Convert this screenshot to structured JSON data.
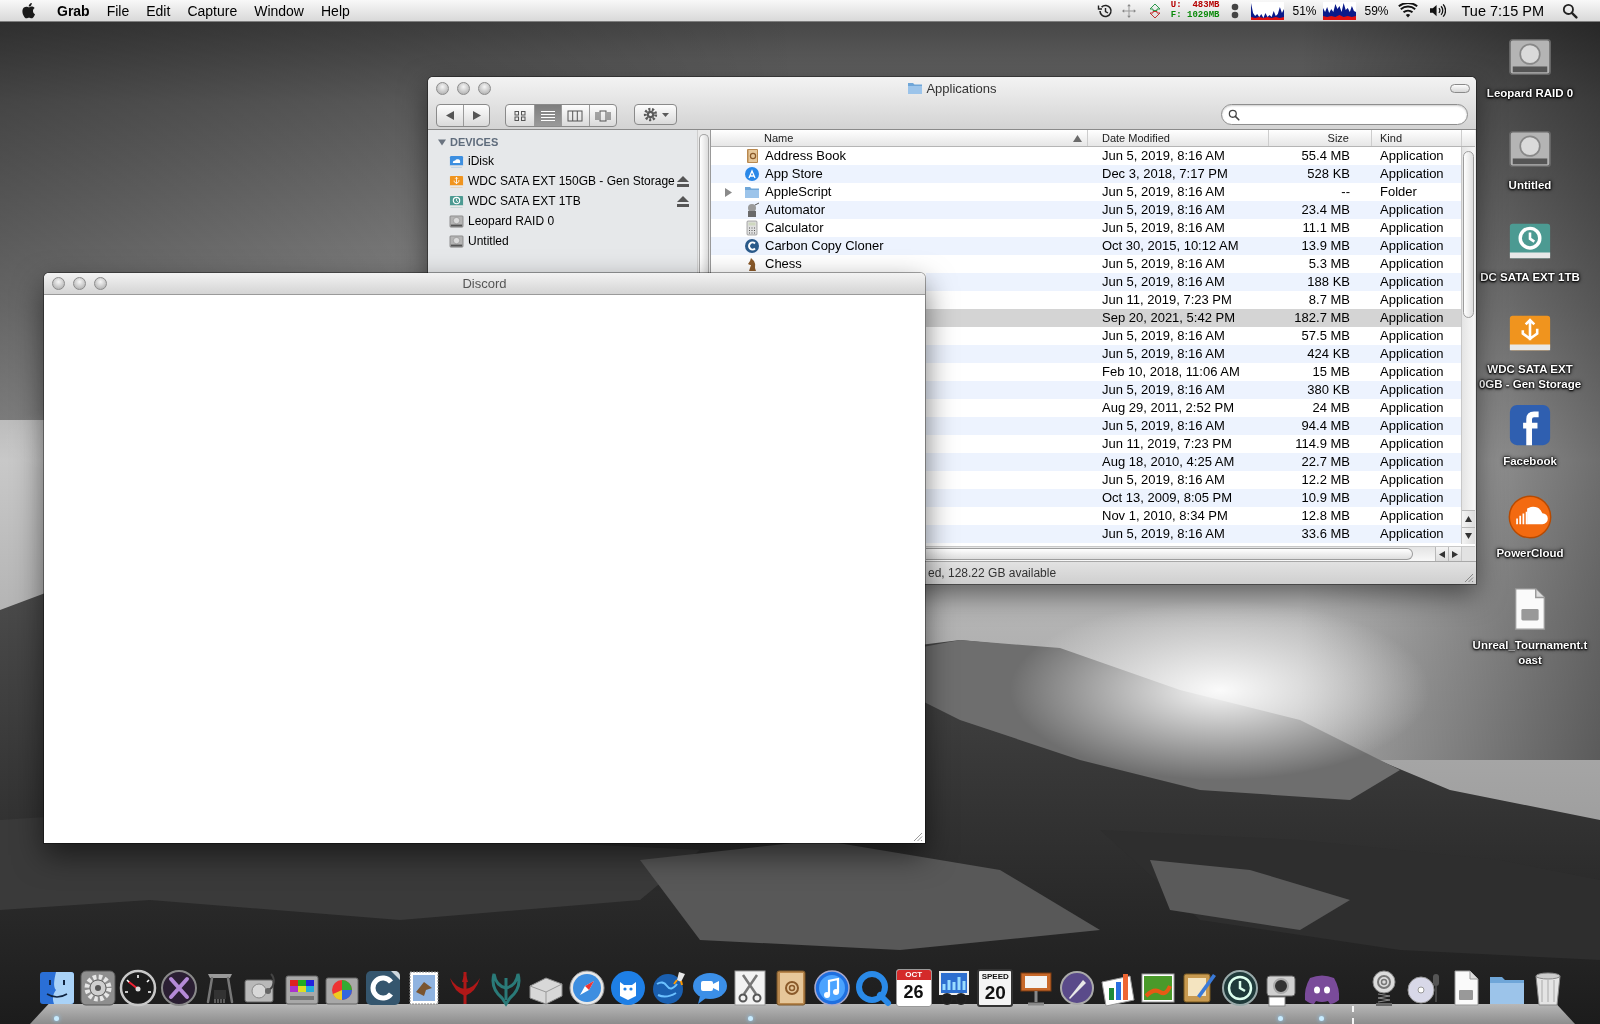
{
  "menu_bar": {
    "app_name": "Grab",
    "menus": [
      "File",
      "Edit",
      "Capture",
      "Window",
      "Help"
    ],
    "memory": [
      {
        "text": "U:  483MB",
        "color": "#b40000"
      },
      {
        "text": "F: 1029MB",
        "color": "#0a8a0a"
      }
    ],
    "meter_readings": [
      "51%",
      "59%"
    ],
    "clock": "Tue 7:15 PM"
  },
  "finder_window": {
    "title": "Applications",
    "view_modes": [
      {
        "selected": false
      },
      {
        "selected": true
      },
      {
        "selected": false
      },
      {
        "selected": false
      }
    ],
    "sidebar": {
      "heading": "DEVICES",
      "expanded": true,
      "items": [
        {
          "label": "iDisk",
          "kind": "idisk",
          "ejectable": false
        },
        {
          "label": "WDC SATA EXT 150GB - Gen Storage",
          "kind": "usb-drive",
          "ejectable": true
        },
        {
          "label": "WDC SATA EXT 1TB",
          "kind": "backup-drive",
          "ejectable": true
        },
        {
          "label": "Leopard RAID 0",
          "kind": "internal-drive",
          "ejectable": false
        },
        {
          "label": "Untitled",
          "kind": "internal-drive",
          "ejectable": false
        }
      ]
    },
    "columns": [
      {
        "label": "Name",
        "sorted": true
      },
      {
        "label": "Date Modified",
        "sorted": false
      },
      {
        "label": "Size",
        "sorted": false
      },
      {
        "label": "Kind",
        "sorted": false
      }
    ],
    "rows": [
      {
        "name": "Address Book",
        "kind": "address-book",
        "date_modified": "Jun 5, 2019, 8:16 AM",
        "size": "55.4 MB",
        "file_kind": "Application",
        "selected": false
      },
      {
        "name": "App Store",
        "kind": "app-store",
        "date_modified": "Dec 3, 2018, 7:17 PM",
        "size": "528 KB",
        "file_kind": "Application",
        "selected": false
      },
      {
        "name": "AppleScript",
        "kind": "folder",
        "date_modified": "Jun 5, 2019, 8:16 AM",
        "size": "--",
        "file_kind": "Folder",
        "selected": false
      },
      {
        "name": "Automator",
        "kind": "automator",
        "date_modified": "Jun 5, 2019, 8:16 AM",
        "size": "23.4 MB",
        "file_kind": "Application",
        "selected": false
      },
      {
        "name": "Calculator",
        "kind": "calculator",
        "date_modified": "Jun 5, 2019, 8:16 AM",
        "size": "11.1 MB",
        "file_kind": "Application",
        "selected": false
      },
      {
        "name": "Carbon Copy Cloner",
        "kind": "cloner",
        "date_modified": "Oct 30, 2015, 10:12 AM",
        "size": "13.9 MB",
        "file_kind": "Application",
        "selected": false
      },
      {
        "name": "Chess",
        "kind": "chess",
        "date_modified": "Jun 5, 2019, 8:16 AM",
        "size": "5.3 MB",
        "file_kind": "Application",
        "selected": false
      },
      {
        "date_modified": "Jun 5, 2019, 8:16 AM",
        "size": "188 KB",
        "file_kind": "Application",
        "selected": false
      },
      {
        "date_modified": "Jun 11, 2019, 7:23 PM",
        "size": "8.7 MB",
        "file_kind": "Application",
        "selected": false
      },
      {
        "date_modified": "Sep 20, 2021, 5:42 PM",
        "size": "182.7 MB",
        "file_kind": "Application",
        "selected": true
      },
      {
        "date_modified": "Jun 5, 2019, 8:16 AM",
        "size": "57.5 MB",
        "file_kind": "Application",
        "selected": false
      },
      {
        "date_modified": "Jun 5, 2019, 8:16 AM",
        "size": "424 KB",
        "file_kind": "Application",
        "selected": false
      },
      {
        "date_modified": "Feb 10, 2018, 11:06 AM",
        "size": "15 MB",
        "file_kind": "Application",
        "selected": false
      },
      {
        "date_modified": "Jun 5, 2019, 8:16 AM",
        "size": "380 KB",
        "file_kind": "Application",
        "selected": false
      },
      {
        "date_modified": "Aug 29, 2011, 2:52 PM",
        "size": "24 MB",
        "file_kind": "Application",
        "selected": false
      },
      {
        "date_modified": "Jun 5, 2019, 8:16 AM",
        "size": "94.4 MB",
        "file_kind": "Application",
        "selected": false
      },
      {
        "date_modified": "Jun 11, 2019, 7:23 PM",
        "size": "114.9 MB",
        "file_kind": "Application",
        "selected": false
      },
      {
        "date_modified": "Aug 18, 2010, 4:25 AM",
        "size": "22.7 MB",
        "file_kind": "Application",
        "selected": false
      },
      {
        "date_modified": "Jun 5, 2019, 8:16 AM",
        "size": "12.2 MB",
        "file_kind": "Application",
        "selected": false
      },
      {
        "date_modified": "Oct 13, 2009, 8:05 PM",
        "size": "10.9 MB",
        "file_kind": "Application",
        "selected": false
      },
      {
        "date_modified": "Nov 1, 2010, 8:34 PM",
        "size": "12.8 MB",
        "file_kind": "Application",
        "selected": false
      },
      {
        "date_modified": "Jun 5, 2019, 8:16 AM",
        "size": "33.6 MB",
        "file_kind": "Application",
        "selected": false
      }
    ],
    "status": "ed, 128.22 GB available"
  },
  "discord_window": {
    "title": "Discord"
  },
  "desktop_icons": [
    {
      "kind": "internal-drive",
      "label_lines": [
        "Leopard RAID 0"
      ]
    },
    {
      "kind": "internal-drive",
      "label_lines": [
        "Untitled"
      ]
    },
    {
      "kind": "backup-drive",
      "label_lines": [
        "DC SATA EXT 1TB"
      ]
    },
    {
      "kind": "usb-drive",
      "label_lines": [
        "WDC SATA EXT",
        "0GB - Gen Storage"
      ]
    },
    {
      "kind": "facebook-app",
      "label_lines": [
        "Facebook"
      ]
    },
    {
      "kind": "cloud-app",
      "label_lines": [
        "PowerCloud"
      ]
    },
    {
      "kind": "document",
      "label_lines": [
        "Unreal_Tournament.t",
        "oast"
      ]
    }
  ],
  "dock": {
    "items": [
      {
        "kind": "app",
        "running": true
      },
      {
        "kind": "app",
        "running": false
      },
      {
        "kind": "app",
        "running": false
      },
      {
        "kind": "app",
        "running": false
      },
      {
        "kind": "app",
        "running": false
      },
      {
        "kind": "app",
        "running": false
      },
      {
        "kind": "app",
        "running": false
      },
      {
        "kind": "app",
        "running": false
      },
      {
        "kind": "app",
        "running": false
      },
      {
        "kind": "app",
        "running": false
      },
      {
        "kind": "app",
        "running": false
      },
      {
        "kind": "app",
        "running": false
      },
      {
        "kind": "app",
        "running": false
      },
      {
        "kind": "app",
        "running": false
      },
      {
        "kind": "app",
        "running": false
      },
      {
        "kind": "app",
        "running": false
      },
      {
        "kind": "app",
        "running": false
      },
      {
        "kind": "app",
        "running": true
      },
      {
        "kind": "app",
        "running": false
      },
      {
        "kind": "app",
        "running": false
      },
      {
        "kind": "app",
        "running": false
      },
      {
        "kind": "app",
        "running": false,
        "icon_text": [
          "OCT",
          "26"
        ]
      },
      {
        "kind": "app",
        "running": false
      },
      {
        "kind": "app",
        "running": false,
        "icon_text": [
          "SPEED",
          "20"
        ]
      },
      {
        "kind": "app",
        "running": false
      },
      {
        "kind": "app",
        "running": false
      },
      {
        "kind": "app",
        "running": false
      },
      {
        "kind": "app",
        "running": false
      },
      {
        "kind": "app",
        "running": false
      },
      {
        "kind": "app",
        "running": false
      },
      {
        "kind": "app",
        "running": true
      },
      {
        "kind": "app",
        "running": true
      },
      {
        "kind": "stack",
        "running": false
      },
      {
        "kind": "stack",
        "running": false
      },
      {
        "kind": "stack",
        "running": false
      },
      {
        "kind": "stack",
        "running": false
      },
      {
        "kind": "stack",
        "running": false
      }
    ]
  }
}
